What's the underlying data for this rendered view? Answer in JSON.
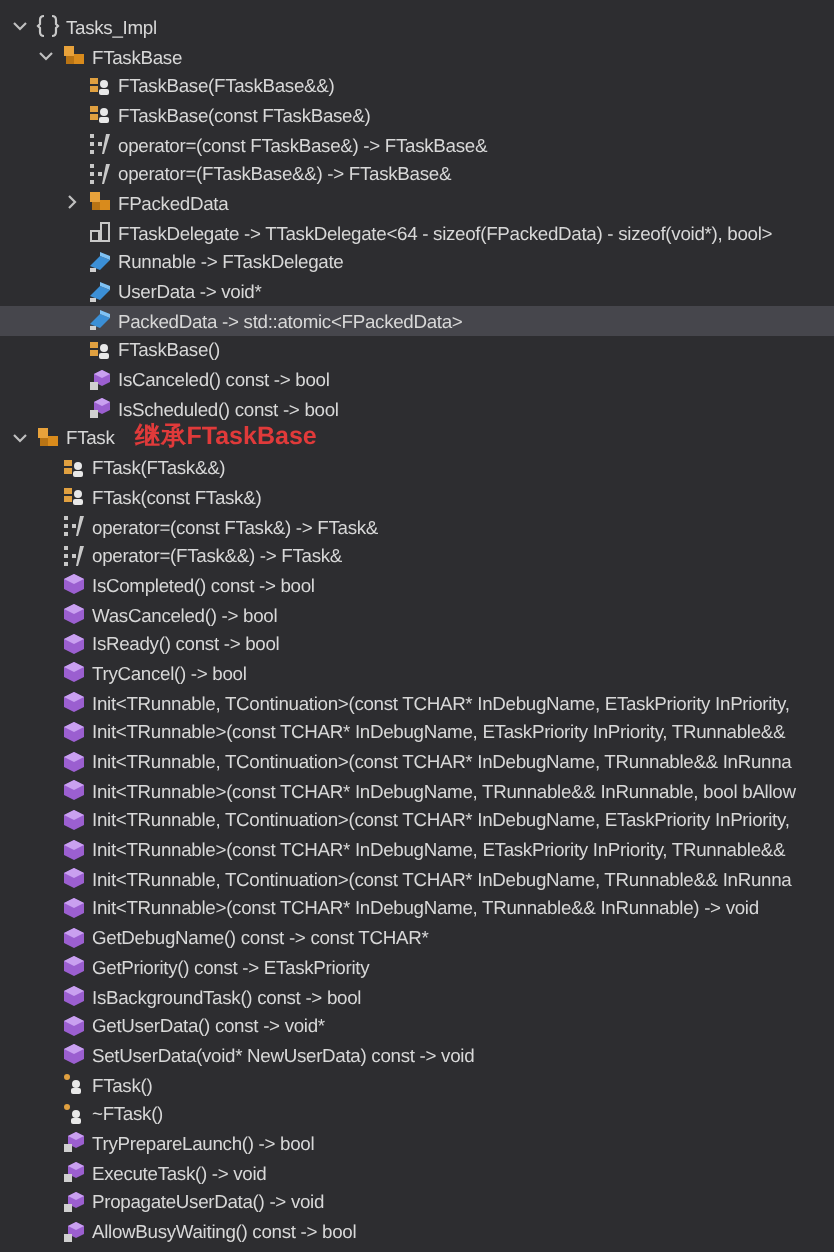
{
  "tree": [
    {
      "label": "Tasks_Impl",
      "kind": "namespace",
      "expanded": true,
      "selected": false,
      "children": [
        {
          "label": "FTaskBase",
          "kind": "class",
          "expanded": true,
          "selected": false,
          "children": [
            {
              "label": "FTaskBase(FTaskBase&&)",
              "kind": "constructor",
              "selected": false
            },
            {
              "label": "FTaskBase(const FTaskBase&)",
              "kind": "constructor",
              "selected": false
            },
            {
              "label": "operator=(const FTaskBase&) -> FTaskBase&",
              "kind": "operator",
              "selected": false
            },
            {
              "label": "operator=(FTaskBase&&) -> FTaskBase&",
              "kind": "operator",
              "selected": false
            },
            {
              "label": "FPackedData",
              "kind": "class",
              "expanded": false,
              "selected": false
            },
            {
              "label": "FTaskDelegate -> TTaskDelegate<64 - sizeof(FPackedData) - sizeof(void*), bool>",
              "kind": "typedef",
              "selected": false
            },
            {
              "label": "Runnable -> FTaskDelegate",
              "kind": "field",
              "selected": false
            },
            {
              "label": "UserData -> void*",
              "kind": "field",
              "selected": false
            },
            {
              "label": "PackedData -> std::atomic<FPackedData>",
              "kind": "field",
              "selected": true
            },
            {
              "label": "FTaskBase()",
              "kind": "constructor",
              "selected": false
            },
            {
              "label": "IsCanceled() const -> bool",
              "kind": "private_method",
              "selected": false
            },
            {
              "label": "IsScheduled() const -> bool",
              "kind": "private_method",
              "selected": false
            }
          ]
        }
      ]
    },
    {
      "label": "FTask",
      "kind": "class",
      "expanded": true,
      "selected": false,
      "annotation": "继承FTaskBase",
      "children": [
        {
          "label": "FTask(FTask&&)",
          "kind": "constructor",
          "selected": false
        },
        {
          "label": "FTask(const FTask&)",
          "kind": "constructor",
          "selected": false
        },
        {
          "label": "operator=(const FTask&) -> FTask&",
          "kind": "operator",
          "selected": false
        },
        {
          "label": "operator=(FTask&&) -> FTask&",
          "kind": "operator",
          "selected": false
        },
        {
          "label": "IsCompleted() const -> bool",
          "kind": "method",
          "selected": false
        },
        {
          "label": "WasCanceled() -> bool",
          "kind": "method",
          "selected": false
        },
        {
          "label": "IsReady() const -> bool",
          "kind": "method",
          "selected": false
        },
        {
          "label": "TryCancel() -> bool",
          "kind": "method",
          "selected": false
        },
        {
          "label": "Init<TRunnable, TContinuation>(const TCHAR* InDebugName, ETaskPriority InPriority,",
          "kind": "method",
          "selected": false
        },
        {
          "label": "Init<TRunnable>(const TCHAR* InDebugName, ETaskPriority InPriority, TRunnable&&",
          "kind": "method",
          "selected": false
        },
        {
          "label": "Init<TRunnable, TContinuation>(const TCHAR* InDebugName, TRunnable&& InRunna",
          "kind": "method",
          "selected": false
        },
        {
          "label": "Init<TRunnable>(const TCHAR* InDebugName, TRunnable&& InRunnable, bool bAllow",
          "kind": "method",
          "selected": false
        },
        {
          "label": "Init<TRunnable, TContinuation>(const TCHAR* InDebugName, ETaskPriority InPriority,",
          "kind": "method",
          "selected": false
        },
        {
          "label": "Init<TRunnable>(const TCHAR* InDebugName, ETaskPriority InPriority, TRunnable&&",
          "kind": "method",
          "selected": false
        },
        {
          "label": "Init<TRunnable, TContinuation>(const TCHAR* InDebugName, TRunnable&& InRunna",
          "kind": "method",
          "selected": false
        },
        {
          "label": "Init<TRunnable>(const TCHAR* InDebugName, TRunnable&& InRunnable) -> void",
          "kind": "method",
          "selected": false
        },
        {
          "label": "GetDebugName() const -> const TCHAR*",
          "kind": "method",
          "selected": false
        },
        {
          "label": "GetPriority() const -> ETaskPriority",
          "kind": "method",
          "selected": false
        },
        {
          "label": "IsBackgroundTask() const -> bool",
          "kind": "method",
          "selected": false
        },
        {
          "label": "GetUserData() const -> void*",
          "kind": "method",
          "selected": false
        },
        {
          "label": "SetUserData(void* NewUserData) const -> void",
          "kind": "method",
          "selected": false
        },
        {
          "label": "FTask()",
          "kind": "private_constructor",
          "selected": false
        },
        {
          "label": "~FTask()",
          "kind": "private_constructor",
          "selected": false
        },
        {
          "label": "TryPrepareLaunch() -> bool",
          "kind": "private_method",
          "selected": false
        },
        {
          "label": "ExecuteTask() -> void",
          "kind": "private_method",
          "selected": false
        },
        {
          "label": "PropagateUserData() -> void",
          "kind": "private_method",
          "selected": false
        },
        {
          "label": "AllowBusyWaiting() const -> bool",
          "kind": "private_method",
          "selected": false
        }
      ]
    }
  ]
}
